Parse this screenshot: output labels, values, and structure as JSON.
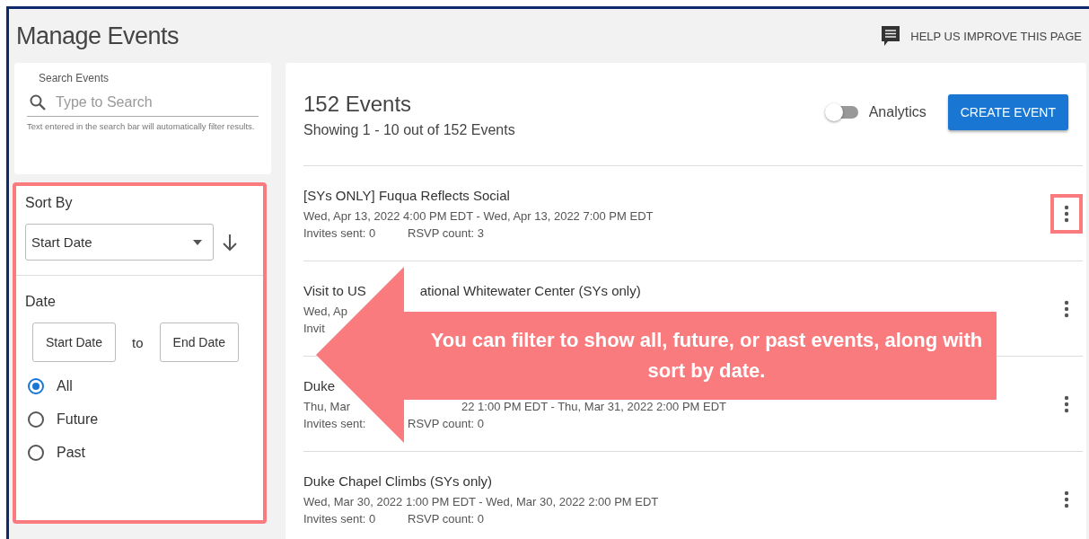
{
  "page": {
    "title": "Manage Events",
    "help_link": "HELP US IMPROVE THIS PAGE"
  },
  "search": {
    "label": "Search Events",
    "placeholder": "Type to Search",
    "hint": "Text entered in the search bar will automatically filter results."
  },
  "filter_panel": {
    "annotated": true,
    "sort_label": "Sort By",
    "sort_value": "Start Date",
    "date_label": "Date",
    "start_button": "Start Date",
    "separator": "to",
    "end_button": "End Date"
  },
  "filters": [
    {
      "label": "All",
      "selected": true
    },
    {
      "label": "Future",
      "selected": false
    },
    {
      "label": "Past",
      "selected": false
    }
  ],
  "events_header": {
    "count_title": "152 Events",
    "showing": "Showing 1 - 10 out of 152 Events",
    "analytics_label": "Analytics",
    "analytics_on": false,
    "create_button": "CREATE EVENT"
  },
  "events": [
    {
      "title": [
        "[SYs ONLY] Fuqua Reflects Social"
      ],
      "dates": [
        "Wed, Apr 13, 2022 4:00 PM EDT - Wed, Apr 13, 2022 7:00 PM EDT"
      ],
      "invites": "Invites sent: 0",
      "rsvp": "RSVP count: 3",
      "menu_annotated": true
    },
    {
      "title": [
        "Visit to US",
        "ational Whitewater Center (SYs only)"
      ],
      "dates": [
        "Wed, Ap"
      ],
      "invites": "Invit",
      "menu_annotated": false
    },
    {
      "title": [
        "Duke"
      ],
      "dates": [
        "Thu, Mar",
        "22 1:00 PM EDT - Thu, Mar 31, 2022 2:00 PM EDT"
      ],
      "invites": "Invites sent:",
      "rsvp": "RSVP count: 0",
      "menu_annotated": false
    },
    {
      "title": [
        "Duke Chapel Climbs (SYs only)"
      ],
      "dates": [
        "Wed, Mar 30, 2022 1:00 PM EDT - Wed, Mar 30, 2022 2:00 PM EDT"
      ],
      "invites": "Invites sent: 0",
      "rsvp": "RSVP count: 0",
      "menu_annotated": false
    }
  ],
  "callout": {
    "text": "You can filter to show all, future, or past events, along with sort by date."
  }
}
